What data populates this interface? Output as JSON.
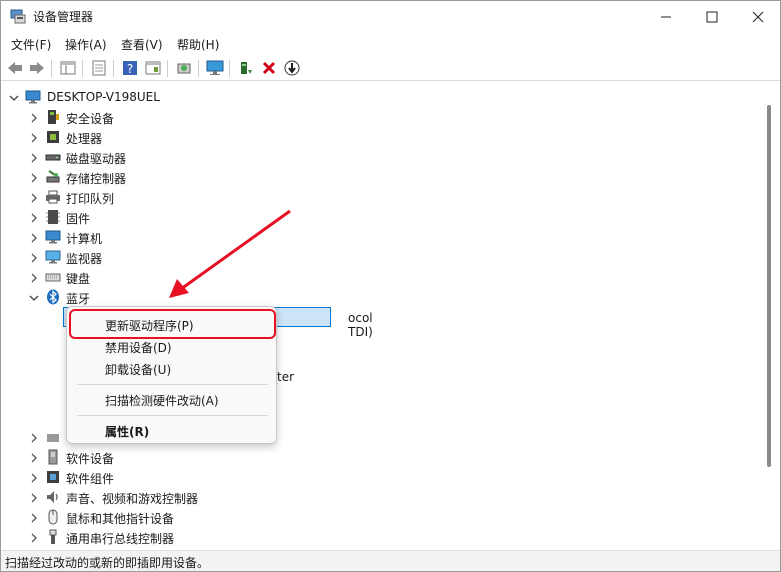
{
  "window": {
    "title": "设备管理器",
    "minimize": "minimize",
    "maximize": "maximize",
    "close": "close"
  },
  "menu": [
    "文件(F)",
    "操作(A)",
    "查看(V)",
    "帮助(H)"
  ],
  "toolbar": [
    "back-icon",
    "forward-icon",
    "properties-pane-icon",
    "show-hide-icon",
    "help-icon",
    "action-pane-icon",
    "update-driver-icon",
    "scan-hardware-icon",
    "enable-device-icon",
    "uninstall-icon",
    "download-icon"
  ],
  "tree": {
    "root": "DESKTOP-V198UEL",
    "categories": [
      {
        "label": "安全设备",
        "icon": "security-icon"
      },
      {
        "label": "处理器",
        "icon": "cpu-icon"
      },
      {
        "label": "磁盘驱动器",
        "icon": "disk-icon"
      },
      {
        "label": "存储控制器",
        "icon": "storage-icon"
      },
      {
        "label": "打印队列",
        "icon": "printer-icon"
      },
      {
        "label": "固件",
        "icon": "firmware-icon"
      },
      {
        "label": "计算机",
        "icon": "computer-icon"
      },
      {
        "label": "监视器",
        "icon": "monitor-icon"
      },
      {
        "label": "键盘",
        "icon": "keyboard-icon"
      },
      {
        "label": "蓝牙",
        "icon": "bluetooth-icon",
        "expanded": true
      }
    ],
    "selected_tail": "ocol TDI)",
    "partial_text": "ter",
    "after": [
      {
        "label": "软件设备",
        "icon": "software-device-icon"
      },
      {
        "label": "软件组件",
        "icon": "software-component-icon"
      },
      {
        "label": "声音、视频和游戏控制器",
        "icon": "sound-icon"
      },
      {
        "label": "鼠标和其他指针设备",
        "icon": "mouse-icon"
      },
      {
        "label": "通用串行总线控制器",
        "icon": "usb-icon"
      }
    ]
  },
  "context_menu": {
    "items": [
      "更新驱动程序(P)",
      "禁用设备(D)",
      "卸载设备(U)",
      "扫描检测硬件改动(A)",
      "属性(R)"
    ]
  },
  "status": "扫描经过改动的或新的即插即用设备。",
  "colors": {
    "accent": "#0078d7",
    "highlight": "#e81123",
    "arrow": "#e81123"
  }
}
